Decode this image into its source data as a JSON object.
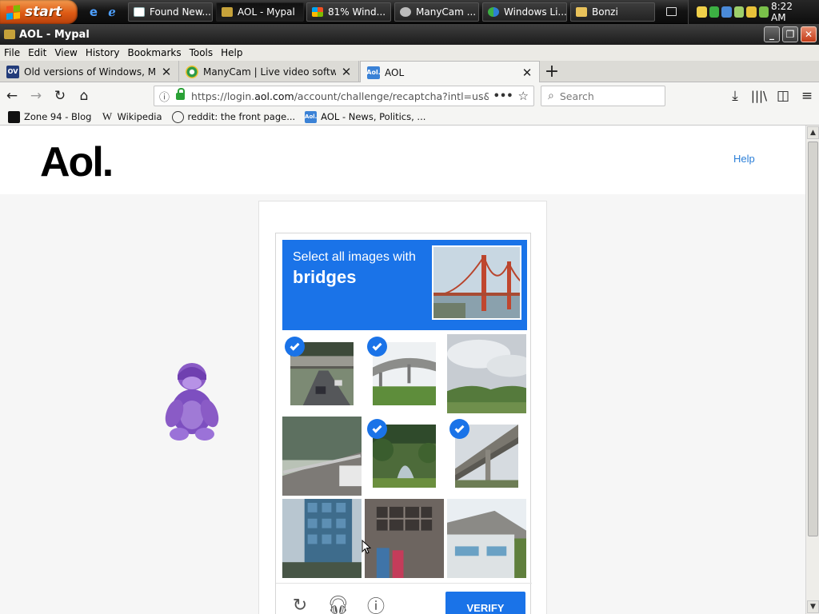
{
  "taskbar": {
    "start_label": "start",
    "buttons": [
      {
        "label": "Found New...",
        "icon": "window-icon"
      },
      {
        "label": "AOL - Mypal",
        "icon": "mypal-icon"
      },
      {
        "label": "81% Wind...",
        "icon": "windows-flag-icon"
      },
      {
        "label": "ManyCam ...",
        "icon": "manycam-icon"
      },
      {
        "label": "Windows Li...",
        "icon": "messenger-icon"
      },
      {
        "label": "Bonzi",
        "icon": "folder-icon"
      }
    ],
    "clock": "8:22 AM"
  },
  "window": {
    "title": "AOL - Mypal"
  },
  "menu": [
    "File",
    "Edit",
    "View",
    "History",
    "Bookmarks",
    "Tools",
    "Help"
  ],
  "tabs": [
    {
      "label": "Old versions of Windows, Mac and",
      "favicon_text": "OV"
    },
    {
      "label": "ManyCam | Live video software &",
      "favicon_text": ""
    },
    {
      "label": "AOL",
      "favicon_text": "Aol."
    }
  ],
  "navbar": {
    "url_host": "https://login.",
    "url_domain": "aol.com",
    "url_path": "/account/challenge/recaptcha?intl=us&",
    "search_placeholder": "Search"
  },
  "bookmarks": [
    {
      "label": "Zone 94 - Blog",
      "icon": "zone94-icon"
    },
    {
      "label": "Wikipedia",
      "icon_text": "W"
    },
    {
      "label": "reddit: the front page...",
      "icon": "globe-icon"
    },
    {
      "label": "AOL - News, Politics, ...",
      "icon_text": "Aol."
    }
  ],
  "page": {
    "logo": "Aol.",
    "help": "Help",
    "captcha": {
      "prompt": "Select all images with",
      "target": "bridges",
      "verify": "VERIFY",
      "tiles": [
        {
          "scene": "road-overpass",
          "selected": true
        },
        {
          "scene": "highway-bridge",
          "selected": true
        },
        {
          "scene": "cloudy-hills",
          "selected": false
        },
        {
          "scene": "guardrail-road",
          "selected": false
        },
        {
          "scene": "arch-bridge-trees",
          "selected": true
        },
        {
          "scene": "elevated-bridge",
          "selected": true
        },
        {
          "scene": "glass-building",
          "selected": false
        },
        {
          "scene": "brick-wall",
          "selected": false
        },
        {
          "scene": "house-roof",
          "selected": false
        }
      ]
    }
  },
  "colors": {
    "captcha_blue": "#1a73e8",
    "link": "#2b7fd8",
    "start_orange": "#dd5a14"
  }
}
